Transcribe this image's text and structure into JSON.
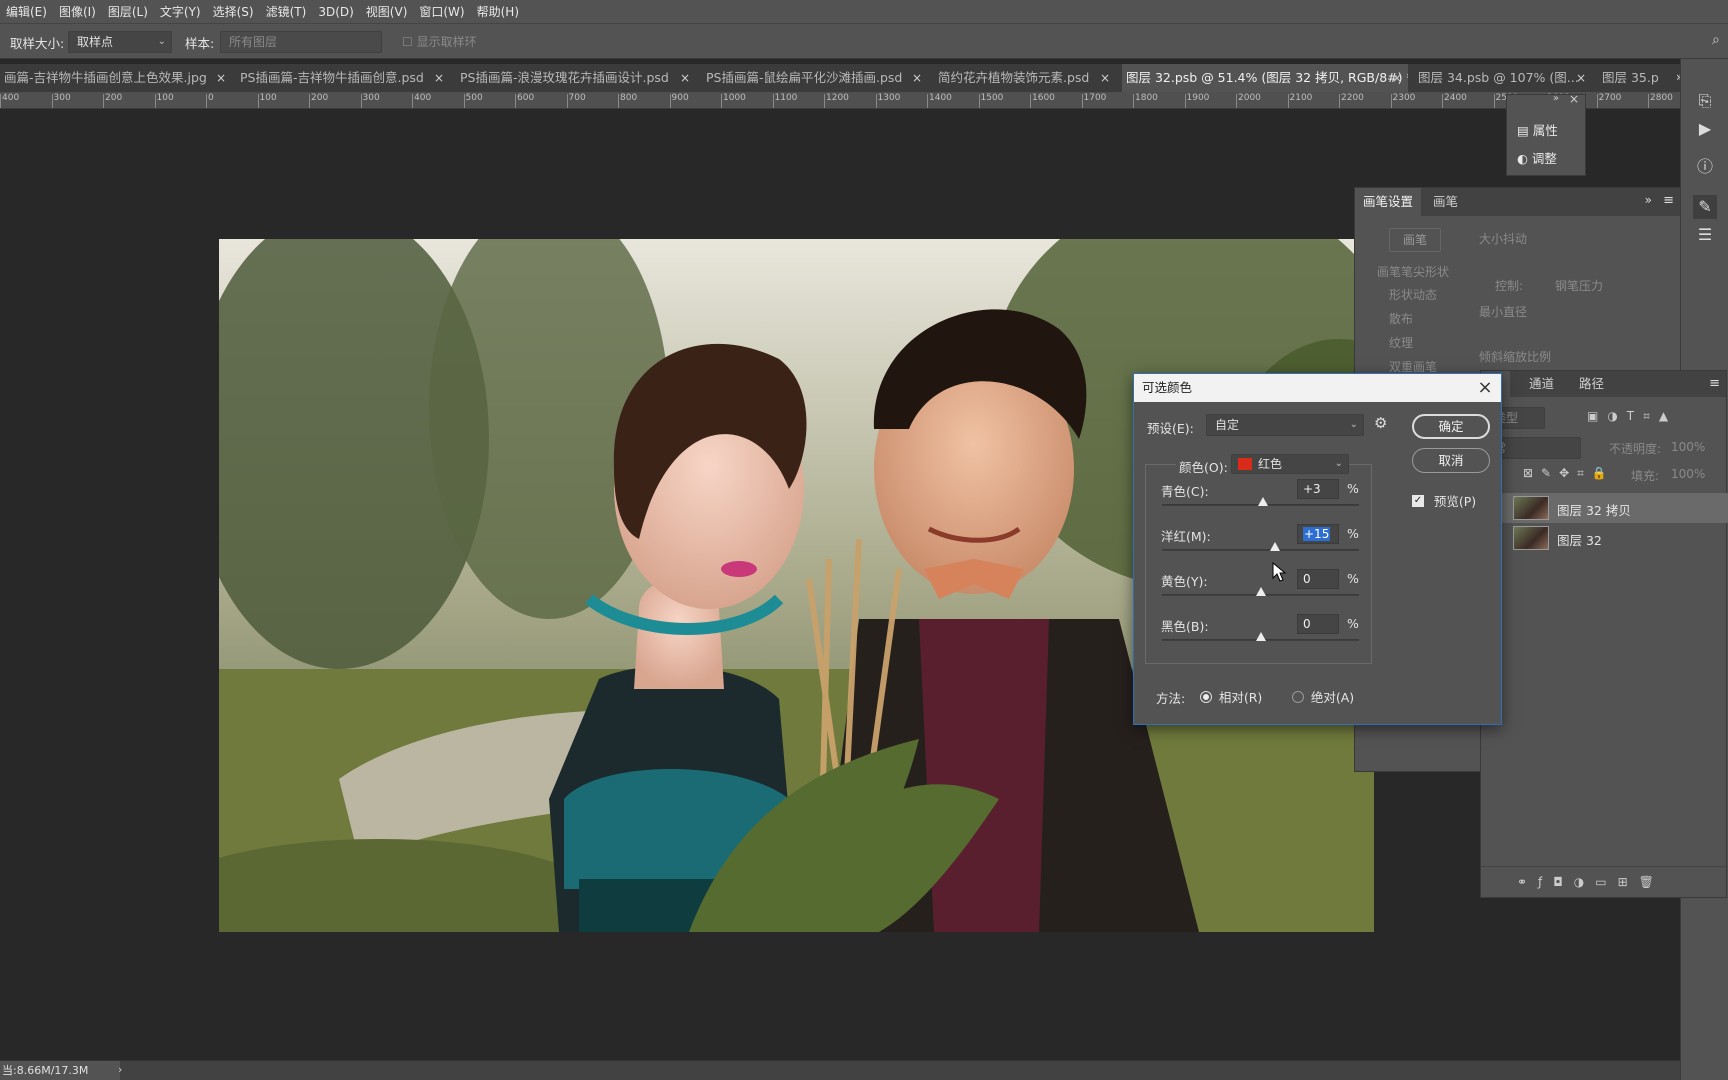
{
  "menu": [
    "编辑(E)",
    "图像(I)",
    "图层(L)",
    "文字(Y)",
    "选择(S)",
    "滤镜(T)",
    "3D(D)",
    "视图(V)",
    "窗口(W)",
    "帮助(H)"
  ],
  "options": {
    "sample_size_label": "取样大小:",
    "sample_size_value": "取样点",
    "sample_label": "样本:",
    "sample_value": "所有图层",
    "show_ring": "显示取样环"
  },
  "tabs": [
    {
      "label": "画篇-吉祥物牛插画创意上色效果.jpg"
    },
    {
      "label": "PS插画篇-吉祥物牛插画创意.psd"
    },
    {
      "label": "PS插画篇-浪漫玫瑰花卉插画设计.psd"
    },
    {
      "label": "PS插画篇-鼠绘扁平化沙滩插画.psd"
    },
    {
      "label": "简约花卉植物装饰元素.psd"
    },
    {
      "label": "图层 32.psb @ 51.4% (图层 32 拷贝, RGB/8#) *"
    },
    {
      "label": "图层 34.psb @ 107% (图..."
    },
    {
      "label": "图层 35.p"
    }
  ],
  "ruler_labels": [
    "400",
    "300",
    "200",
    "100",
    "0",
    "100",
    "200",
    "300",
    "400",
    "500",
    "600",
    "700",
    "800",
    "900",
    "1000",
    "1100",
    "1200",
    "1300",
    "1400",
    "1500",
    "1600",
    "1700",
    "1800",
    "1900",
    "2000",
    "2100",
    "2200",
    "2300",
    "2400",
    "2500",
    "2600",
    "2700",
    "2800"
  ],
  "mini_panel": {
    "items": [
      "属性",
      "调整"
    ]
  },
  "brush_panel": {
    "tabs": [
      "画笔设置",
      "画笔"
    ],
    "brush_button": "画笔",
    "tip_shape": "画笔笔尖形状",
    "options": [
      "形状动态",
      "散布",
      "纹理",
      "双重画笔"
    ],
    "size_jitter": "大小抖动",
    "control_label": "控制:",
    "control_value": "钢笔压力",
    "min_diameter": "最小直径",
    "tilt_scale": "倾斜缩放比例"
  },
  "layers_panel": {
    "tabs": [
      "层",
      "通道",
      "路径"
    ],
    "filter_kind": "类型",
    "blend_mode": "常",
    "opacity_label": "不透明度:",
    "opacity_value": "100%",
    "lock_label": "定:",
    "fill_label": "填充:",
    "fill_value": "100%",
    "layers": [
      {
        "name": "图层 32 拷贝",
        "selected": true
      },
      {
        "name": "图层 32",
        "selected": false
      }
    ]
  },
  "dialog": {
    "title": "可选颜色",
    "preset_label": "预设(E):",
    "preset_value": "自定",
    "colors_label": "颜色(O):",
    "colors_value": "红色",
    "colors_swatch": "#d92b1a",
    "ok": "确定",
    "cancel": "取消",
    "preview": "预览(P)",
    "preview_checked": true,
    "sliders": [
      {
        "label": "青色(C):",
        "value": "+3",
        "unit": "%",
        "level": 0.515,
        "selected": false
      },
      {
        "label": "洋红(M):",
        "value": "+15",
        "unit": "%",
        "level": 0.575,
        "selected": true
      },
      {
        "label": "黄色(Y):",
        "value": "0",
        "unit": "%",
        "level": 0.5,
        "selected": false
      },
      {
        "label": "黑色(B):",
        "value": "0",
        "unit": "%",
        "level": 0.5,
        "selected": false
      }
    ],
    "method_label": "方法:",
    "method_relative": "相对(R)",
    "method_absolute": "绝对(A)",
    "method_selected": "relative"
  },
  "status": {
    "doc_size": "当:8.66M/17.3M"
  }
}
